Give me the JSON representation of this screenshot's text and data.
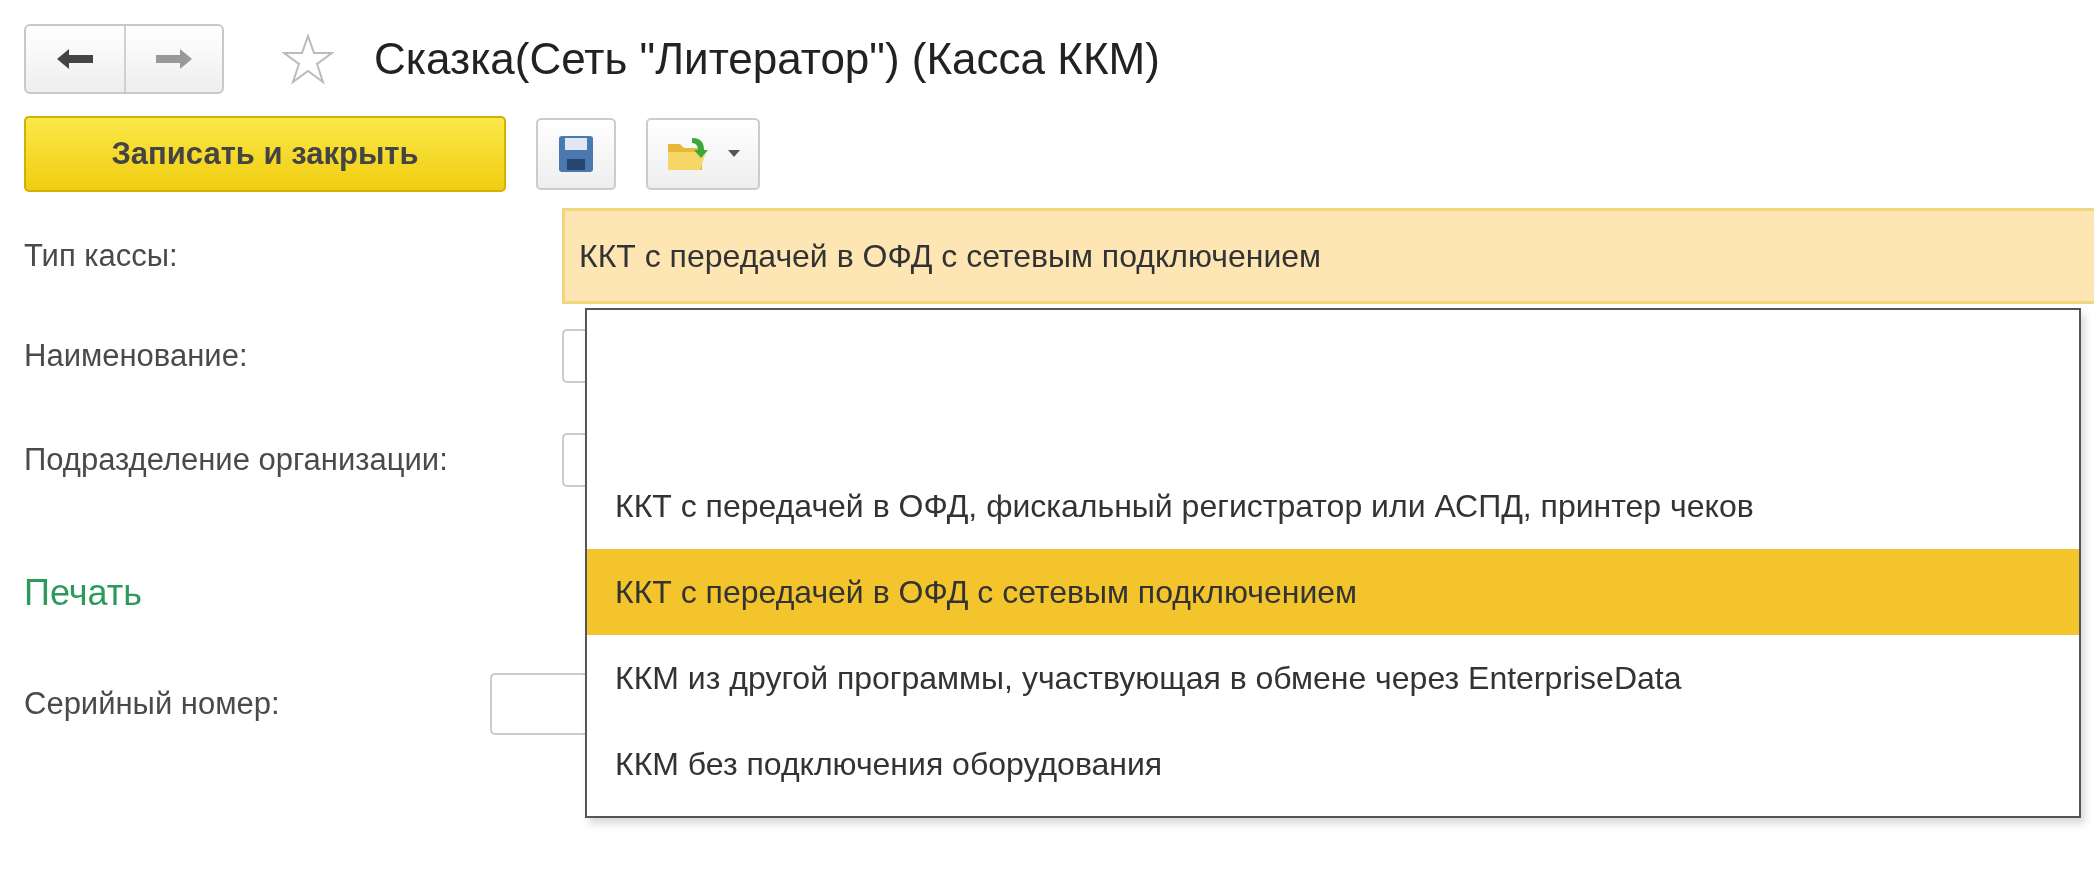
{
  "title": "Сказка(Сеть \"Литератор\") (Касса ККМ)",
  "toolbar": {
    "primary_button": "Записать и закрыть"
  },
  "fields": [
    {
      "label": "Тип кассы:",
      "value": "ККТ с передачей в ОФД с сетевым подключением",
      "kind": "select",
      "focused": true
    },
    {
      "label": "Наименование:",
      "kind": "text",
      "focused": false
    },
    {
      "label": "Подразделение организации:",
      "kind": "text",
      "focused": false
    }
  ],
  "section": {
    "title": "Печать",
    "fields": [
      {
        "label": "Серийный номер:",
        "kind": "text"
      }
    ]
  },
  "dropdown": {
    "options": [
      {
        "label": "ККТ с передачей в ОФД, фискальный регистратор или АСПД, принтер чеков",
        "selected": false
      },
      {
        "label": "ККТ с передачей в ОФД с сетевым подключением",
        "selected": true
      },
      {
        "label": "ККМ из другой программы, участвующая в обмене через EnterpriseData",
        "selected": false
      },
      {
        "label": "ККМ без подключения оборудования",
        "selected": false
      }
    ]
  }
}
